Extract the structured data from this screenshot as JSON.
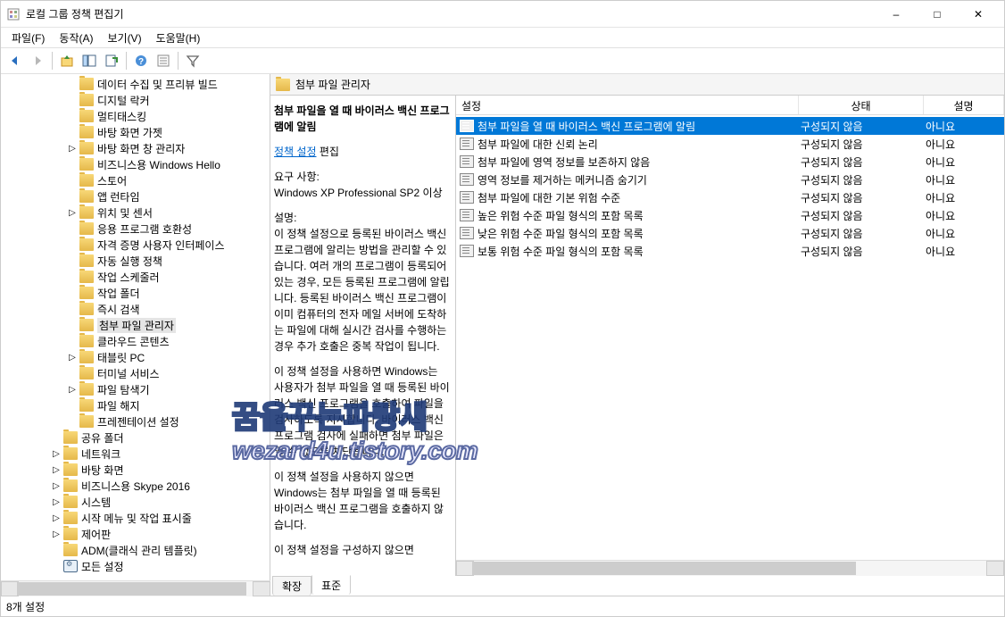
{
  "window": {
    "title": "로컬 그룹 정책 편집기",
    "minimize": "–",
    "maximize": "□",
    "close": "✕"
  },
  "menu": {
    "file": "파일(F)",
    "action": "동작(A)",
    "view": "보기(V)",
    "help": "도움말(H)"
  },
  "tree": {
    "items": [
      {
        "depth": 4,
        "exp": "none",
        "icon": "folder",
        "label": "데이터 수집 및 프리뷰 빌드"
      },
      {
        "depth": 4,
        "exp": "none",
        "icon": "folder",
        "label": "디지털 락커"
      },
      {
        "depth": 4,
        "exp": "none",
        "icon": "folder",
        "label": "멀티태스킹"
      },
      {
        "depth": 4,
        "exp": "none",
        "icon": "folder",
        "label": "바탕 화면 가젯"
      },
      {
        "depth": 4,
        "exp": "closed",
        "icon": "folder",
        "label": "바탕 화면 창 관리자"
      },
      {
        "depth": 4,
        "exp": "none",
        "icon": "folder",
        "label": "비즈니스용 Windows Hello"
      },
      {
        "depth": 4,
        "exp": "none",
        "icon": "folder",
        "label": "스토어"
      },
      {
        "depth": 4,
        "exp": "none",
        "icon": "folder",
        "label": "앱 런타임"
      },
      {
        "depth": 4,
        "exp": "closed",
        "icon": "folder",
        "label": "위치 및 센서"
      },
      {
        "depth": 4,
        "exp": "none",
        "icon": "folder",
        "label": "응용 프로그램 호환성"
      },
      {
        "depth": 4,
        "exp": "none",
        "icon": "folder",
        "label": "자격 증명 사용자 인터페이스"
      },
      {
        "depth": 4,
        "exp": "none",
        "icon": "folder",
        "label": "자동 실행 정책"
      },
      {
        "depth": 4,
        "exp": "none",
        "icon": "folder",
        "label": "작업 스케줄러"
      },
      {
        "depth": 4,
        "exp": "none",
        "icon": "folder",
        "label": "작업 폴더"
      },
      {
        "depth": 4,
        "exp": "none",
        "icon": "folder",
        "label": "즉시 검색"
      },
      {
        "depth": 4,
        "exp": "none",
        "icon": "folder",
        "label": "첨부 파일 관리자",
        "selected": true
      },
      {
        "depth": 4,
        "exp": "none",
        "icon": "folder",
        "label": "클라우드 콘텐츠"
      },
      {
        "depth": 4,
        "exp": "closed",
        "icon": "folder",
        "label": "태블릿 PC"
      },
      {
        "depth": 4,
        "exp": "none",
        "icon": "folder",
        "label": "터미널 서비스"
      },
      {
        "depth": 4,
        "exp": "closed",
        "icon": "folder",
        "label": "파일 탐색기"
      },
      {
        "depth": 4,
        "exp": "none",
        "icon": "folder",
        "label": "파일 해지"
      },
      {
        "depth": 4,
        "exp": "none",
        "icon": "folder",
        "label": "프레젠테이션 설정"
      },
      {
        "depth": 3,
        "exp": "none",
        "icon": "folder",
        "label": "공유 폴더"
      },
      {
        "depth": 3,
        "exp": "closed",
        "icon": "folder",
        "label": "네트워크"
      },
      {
        "depth": 3,
        "exp": "closed",
        "icon": "folder",
        "label": "바탕 화면"
      },
      {
        "depth": 3,
        "exp": "closed",
        "icon": "folder",
        "label": "비즈니스용 Skype 2016"
      },
      {
        "depth": 3,
        "exp": "closed",
        "icon": "folder",
        "label": "시스템"
      },
      {
        "depth": 3,
        "exp": "closed",
        "icon": "folder",
        "label": "시작 메뉴 및 작업 표시줄"
      },
      {
        "depth": 3,
        "exp": "closed",
        "icon": "folder",
        "label": "제어판"
      },
      {
        "depth": 3,
        "exp": "none",
        "icon": "folder",
        "label": "ADM(클래식 관리 템플릿)"
      },
      {
        "depth": 3,
        "exp": "none",
        "icon": "settings",
        "label": "모든 설정"
      }
    ]
  },
  "path_header": "첨부 파일 관리자",
  "description": {
    "title": "첨부 파일을 열 때 바이러스 백신 프로그램에 알림",
    "policy_link": "정책 설정",
    "policy_edit": "편집",
    "req_label": "요구 사항:",
    "req_text": "Windows XP Professional SP2 이상",
    "desc_label": "설명:",
    "desc_p1": "이 정책 설정으로 등록된 바이러스 백신 프로그램에 알리는 방법을 관리할 수 있습니다. 여러 개의 프로그램이 등록되어 있는 경우, 모든 등록된 프로그램에 알립니다. 등록된 바이러스 백신 프로그램이 이미 컴퓨터의 전자 메일 서버에 도착하는 파일에 대해 실시간 검사를 수행하는 경우 추가 호출은 중복 작업이 됩니다.",
    "desc_p2": "이 정책 설정을 사용하면 Windows는 사용자가 첨부 파일을 열 때 등록된 바이러스 백신 프로그램을 호출하여 파일을 검사하도록 지시합니다. 바이러스 백신 프로그램 검사에 실패하면 첨부 파일은 열 수 없도록 차단됩니다.",
    "desc_p3": "이 정책 설정을 사용하지 않으면 Windows는 첨부 파일을 열 때 등록된 바이러스 백신 프로그램을 호출하지 않습니다.",
    "desc_p4": "이 정책 설정을 구성하지 않으면"
  },
  "columns": {
    "c1": "설정",
    "c2": "상태",
    "c3": "설명"
  },
  "rows": [
    {
      "name": "첨부 파일을 열 때 바이러스 백신 프로그램에 알림",
      "state": "구성되지 않음",
      "comment": "아니요",
      "selected": true
    },
    {
      "name": "첨부 파일에 대한 신뢰 논리",
      "state": "구성되지 않음",
      "comment": "아니요"
    },
    {
      "name": "첨부 파일에 영역 정보를 보존하지 않음",
      "state": "구성되지 않음",
      "comment": "아니요"
    },
    {
      "name": "영역 정보를 제거하는 메커니즘 숨기기",
      "state": "구성되지 않음",
      "comment": "아니요"
    },
    {
      "name": "첨부 파일에 대한 기본 위험 수준",
      "state": "구성되지 않음",
      "comment": "아니요"
    },
    {
      "name": "높은 위험 수준 파일 형식의 포함 목록",
      "state": "구성되지 않음",
      "comment": "아니요"
    },
    {
      "name": "낮은 위험 수준 파일 형식의 포함 목록",
      "state": "구성되지 않음",
      "comment": "아니요"
    },
    {
      "name": "보통 위험 수준 파일 형식의 포함 목록",
      "state": "구성되지 않음",
      "comment": "아니요"
    }
  ],
  "tabs": {
    "extended": "확장",
    "standard": "표준"
  },
  "status": "8개 설정",
  "watermark": {
    "line1": "꿈을꾸는파랑새",
    "line2": "wezard4u.tistory.com"
  }
}
